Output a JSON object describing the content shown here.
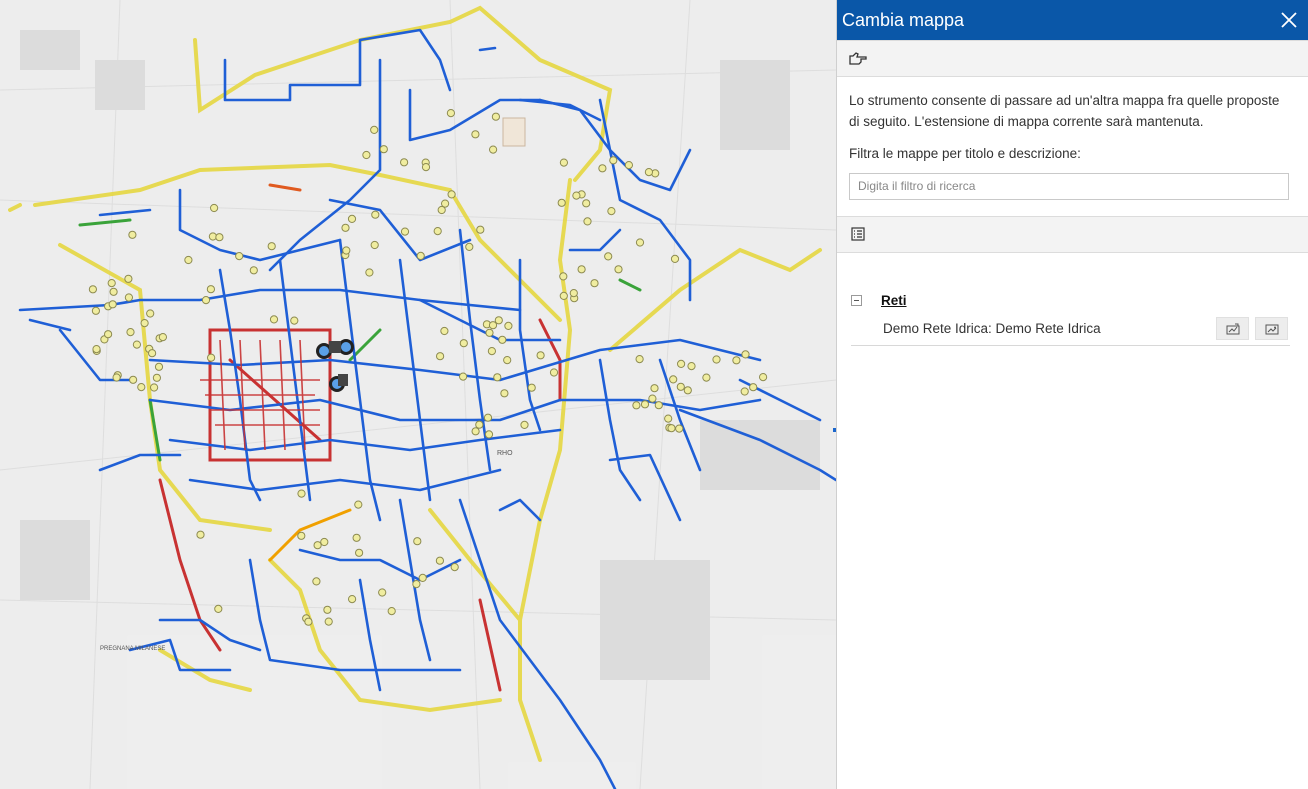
{
  "panel": {
    "title": "Cambia mappa",
    "description": "Lo strumento consente di passare ad un'altra mappa fra quelle proposte di seguito. L'estensione di mappa corrente sarà mantenuta.",
    "filter_label": "Filtra le mappe per titolo e descrizione:",
    "filter_placeholder": "Digita il filtro di ricerca",
    "groups": [
      {
        "title": "Reti",
        "maps": [
          {
            "name": "Demo Rete Idrica: Demo Rete Idrica"
          }
        ]
      }
    ],
    "icons": {
      "close": "close-icon",
      "tool": "pointing-hand-icon",
      "list": "list-icon",
      "collapse": "minus-square-icon",
      "open_map": "open-map-icon",
      "open_new": "open-map-new-window-icon"
    }
  },
  "map_labels": {
    "town_1": "RHO",
    "town_2": "PREGNANA MILANESE"
  },
  "colors": {
    "header": "#0a57a8",
    "network_blue": "#1f5fd6",
    "road_yellow": "#e6d84a",
    "pipe_red": "#c83232",
    "pipe_green": "#3aa33a"
  }
}
